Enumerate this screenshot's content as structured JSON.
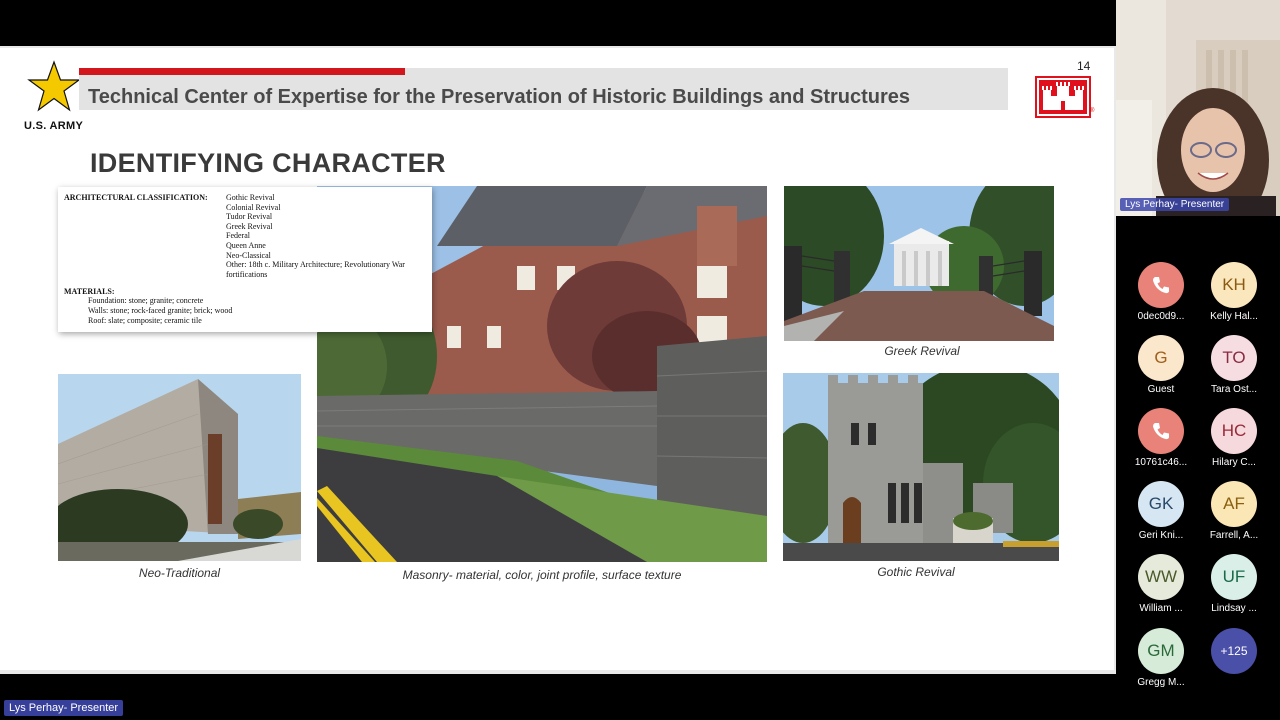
{
  "slide": {
    "org_name": "U.S. ARMY",
    "header_title": "Technical Center of Expertise for the Preservation of Historic Buildings and Structures",
    "slide_number": "14",
    "heading": "IDENTIFYING CHARACTER",
    "classification": {
      "label": "ARCHITECTURAL CLASSIFICATION:",
      "items": [
        "Gothic Revival",
        "Colonial Revival",
        "Tudor Revival",
        "Greek Revival",
        "Federal",
        "Queen Anne",
        "Neo-Classical",
        "Other:  18th c. Military Architecture; Revolutionary War",
        "fortifications"
      ],
      "materials_label": "MATERIALS:",
      "materials": [
        "Foundation:  stone; granite; concrete",
        "Walls:  stone; rock-faced granite; brick; wood",
        "Roof:  slate; composite; ceramic tile"
      ]
    },
    "captions": {
      "neo_traditional": "Neo-Traditional",
      "masonry": "Masonry- material, color, joint profile, surface texture",
      "greek_revival": "Greek Revival",
      "gothic_revival": "Gothic Revival"
    },
    "colors": {
      "accent_red": "#d3161d",
      "header_gray": "#e3e3e3"
    }
  },
  "presenter": {
    "name": "Lys Perhay- Presenter"
  },
  "participants": [
    {
      "initials": "",
      "name": "0dec0d9...",
      "icon": "phone-icon",
      "bg": "#e9837a",
      "fg": "#ffffff"
    },
    {
      "initials": "KH",
      "name": "Kelly Hal...",
      "bg": "#fbe7bd",
      "fg": "#8a5a10"
    },
    {
      "initials": "G",
      "name": "Guest",
      "bg": "#fbe7cc",
      "fg": "#a0601a"
    },
    {
      "initials": "TO",
      "name": "Tara Ost...",
      "bg": "#f6dde2",
      "fg": "#8a2a40"
    },
    {
      "initials": "",
      "name": "10761c46...",
      "icon": "phone-icon",
      "bg": "#e9837a",
      "fg": "#ffffff"
    },
    {
      "initials": "HC",
      "name": "Hilary C...",
      "bg": "#f6d9dd",
      "fg": "#9a2a3a"
    },
    {
      "initials": "GK",
      "name": "Geri Kni...",
      "bg": "#d6e6f2",
      "fg": "#2a4a6a"
    },
    {
      "initials": "AF",
      "name": "Farrell, A...",
      "bg": "#fbe7b5",
      "fg": "#8a6010"
    },
    {
      "initials": "WW",
      "name": "William ...",
      "bg": "#e6eadb",
      "fg": "#4a5a2a"
    },
    {
      "initials": "UF",
      "name": "Lindsay ...",
      "bg": "#d9efe7",
      "fg": "#1a6a4a"
    },
    {
      "initials": "GM",
      "name": "Gregg M...",
      "bg": "#d6ecd8",
      "fg": "#2a6a3a"
    }
  ],
  "more_participants": "+125",
  "bottom_presenter_label": "Lys Perhay- Presenter"
}
